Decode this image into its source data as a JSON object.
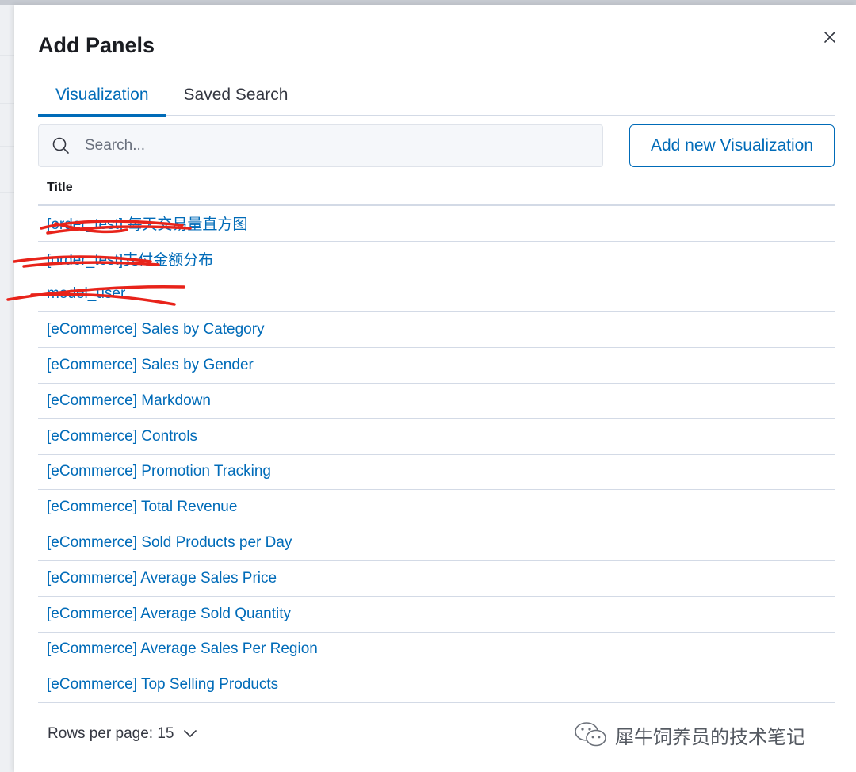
{
  "panel": {
    "title": "Add Panels",
    "close_label": "×"
  },
  "tabs": [
    {
      "label": "Visualization",
      "active": true
    },
    {
      "label": "Saved Search",
      "active": false
    }
  ],
  "search": {
    "placeholder": "Search...",
    "value": ""
  },
  "add_button": {
    "label": "Add new Visualization"
  },
  "table": {
    "column_header": "Title",
    "rows": [
      {
        "title": "[order_test] 每天交易量直方图",
        "redacted": true
      },
      {
        "title": "[order_test]支付金额分布",
        "redacted": true
      },
      {
        "title": "model_user",
        "redacted": true
      },
      {
        "title": "[eCommerce] Sales by Category"
      },
      {
        "title": "[eCommerce] Sales by Gender"
      },
      {
        "title": "[eCommerce] Markdown"
      },
      {
        "title": "[eCommerce] Controls"
      },
      {
        "title": "[eCommerce] Promotion Tracking"
      },
      {
        "title": "[eCommerce] Total Revenue"
      },
      {
        "title": "[eCommerce] Sold Products per Day"
      },
      {
        "title": "[eCommerce] Average Sales Price"
      },
      {
        "title": "[eCommerce] Average Sold Quantity"
      },
      {
        "title": "[eCommerce] Average Sales Per Region"
      },
      {
        "title": "[eCommerce] Top Selling Products"
      }
    ]
  },
  "pagination": {
    "rows_per_page_label": "Rows per page: 15"
  },
  "watermark": {
    "text": "犀牛饲养员的技术笔记",
    "icon": "wechat-icon"
  },
  "colors": {
    "accent": "#006bb8",
    "text": "#1a1c21",
    "border": "#d3dae6",
    "scribble": "#e8231a"
  }
}
